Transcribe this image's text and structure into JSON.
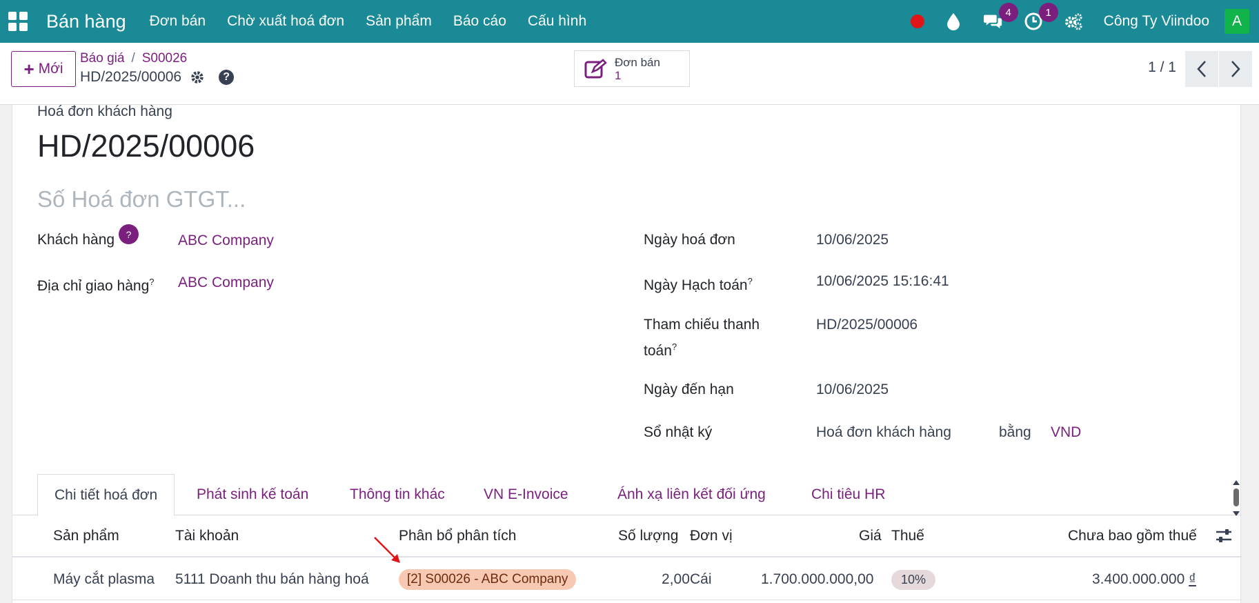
{
  "navbar": {
    "brand": "Bán hàng",
    "menu": [
      "Đơn bán",
      "Chờ xuất hoá đơn",
      "Sản phẩm",
      "Báo cáo",
      "Cấu hình"
    ],
    "messages_count": "4",
    "activities_count": "1",
    "company": "Công Ty Viindoo",
    "avatar_letter": "A"
  },
  "control": {
    "new_label": "Mới",
    "breadcrumb": [
      "Báo giá",
      "S00026"
    ],
    "record_title": "HD/2025/00006",
    "smart_button": {
      "label": "Đơn bán",
      "value": "1"
    },
    "pager": "1 / 1"
  },
  "invoice": {
    "doc_type": "Hoá đơn khách hàng",
    "name": "HD/2025/00006",
    "vat_placeholder": "Số Hoá đơn GTGT...",
    "help_mark": "?",
    "left_fields": [
      {
        "label": "Khách hàng",
        "value": "ABC Company"
      },
      {
        "label": "Địa chỉ giao hàng",
        "value": "ABC Company"
      }
    ],
    "right_fields": {
      "invoice_date_label": "Ngày hoá đơn",
      "invoice_date": "10/06/2025",
      "accounting_date_label": "Ngày Hạch toán",
      "accounting_date": "10/06/2025 15:16:41",
      "payment_ref_label_1": "Tham chiếu thanh",
      "payment_ref_label_2": "toán",
      "payment_ref": "HD/2025/00006",
      "due_date_label": "Ngày đến hạn",
      "due_date": "10/06/2025",
      "journal_label": "Sổ nhật ký",
      "journal": "Hoá đơn khách hàng",
      "currency_word": "bằng",
      "currency": "VND"
    }
  },
  "tabs": [
    "Chi tiết hoá đơn",
    "Phát sinh kế toán",
    "Thông tin khác",
    "VN E-Invoice",
    "Ánh xạ liên kết đối ứng",
    "Chi tiêu HR"
  ],
  "table": {
    "headers": [
      "Sản phẩm",
      "Tài khoản",
      "Phân bổ phân tích",
      "Số lượng",
      "Đơn vị",
      "Giá",
      "Thuế",
      "Chưa bao gồm thuế"
    ],
    "rows": [
      {
        "product": "Máy cắt plasma",
        "account": "5111 Doanh thu bán hàng hoá",
        "analytic": "[2] S00026 - ABC Company",
        "qty": "2,00",
        "uom": "Cái",
        "price": "1.700.000.000,00",
        "tax": "10%",
        "subtotal": "3.400.000.000",
        "currency_symbol": "₫"
      }
    ]
  },
  "colors": {
    "navbar": "#1a8a96",
    "accent": "#7b1f7e",
    "record_dot": "#e0151a",
    "avatar": "#10b44b",
    "analytic_tag": "#f8c9b2",
    "annotation_arrow": "#e0151a"
  }
}
